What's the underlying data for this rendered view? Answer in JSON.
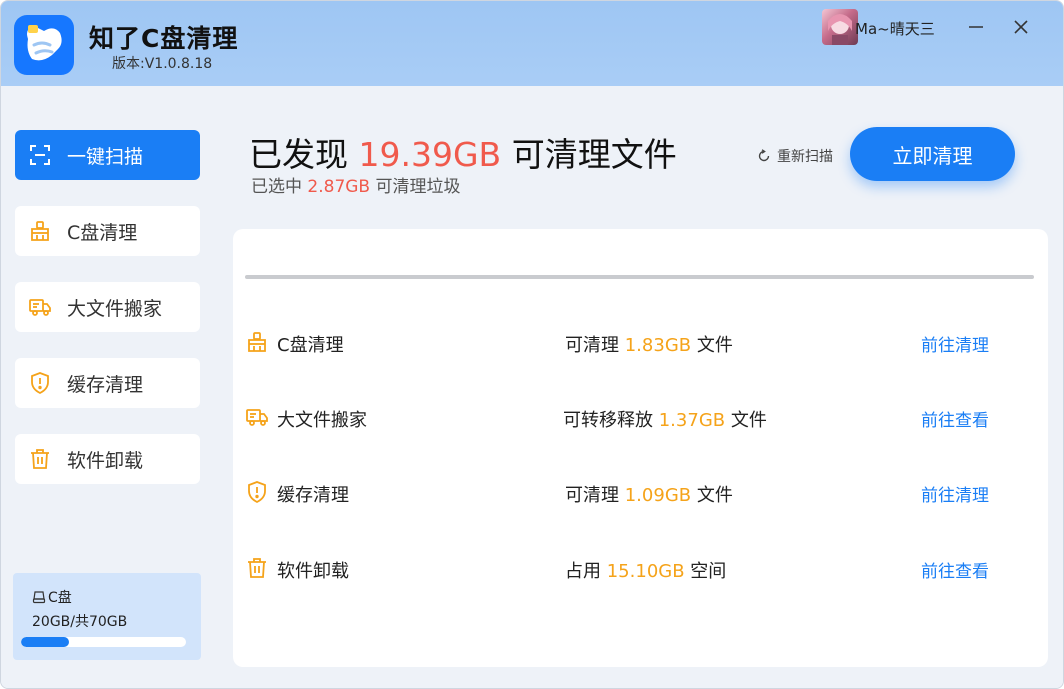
{
  "app": {
    "title": "知了C盘清理",
    "version": "版本:V1.0.8.18",
    "logo_icon": "broom-logo-icon",
    "brand_color": "#1a7ef5"
  },
  "user": {
    "name": "Ma~晴天三"
  },
  "window_controls": {
    "minimize": "—",
    "close": "✕"
  },
  "sidebar": {
    "items": [
      {
        "label": "一键扫描",
        "icon": "scan-icon",
        "active": true
      },
      {
        "label": "C盘清理",
        "icon": "broom-icon",
        "active": false
      },
      {
        "label": "大文件搬家",
        "icon": "truck-icon",
        "active": false
      },
      {
        "label": "缓存清理",
        "icon": "shield-icon",
        "active": false
      },
      {
        "label": "软件卸载",
        "icon": "trash-icon",
        "active": false
      }
    ],
    "disk": {
      "label": "C盘",
      "usage": "20GB/共70GB",
      "used_fraction": 0.29
    }
  },
  "main": {
    "headline_prefix": "已发现",
    "headline_amount": "19.39GB",
    "headline_suffix": "可清理文件",
    "sub_prefix": "已选中",
    "sub_amount": "2.87GB",
    "sub_suffix": "可清理垃圾",
    "rescan_label": "重新扫描",
    "clean_button": "立即清理",
    "accent_red": "#f05a4c",
    "accent_orange": "#f5a31a"
  },
  "results": [
    {
      "name": "C盘清理",
      "icon": "broom-icon",
      "info_prefix": "可清理",
      "amount": "1.83GB",
      "info_suffix": "文件",
      "action": "前往清理"
    },
    {
      "name": "大文件搬家",
      "icon": "truck-icon",
      "info_prefix": "可转移释放",
      "amount": "1.37GB",
      "info_suffix": "文件",
      "action": "前往查看"
    },
    {
      "name": "缓存清理",
      "icon": "shield-icon",
      "info_prefix": "可清理",
      "amount": "1.09GB",
      "info_suffix": "文件",
      "action": "前往清理"
    },
    {
      "name": "软件卸载",
      "icon": "trash-icon",
      "info_prefix": "占用",
      "amount": "15.10GB",
      "info_suffix": "空间",
      "action": "前往查看"
    }
  ]
}
